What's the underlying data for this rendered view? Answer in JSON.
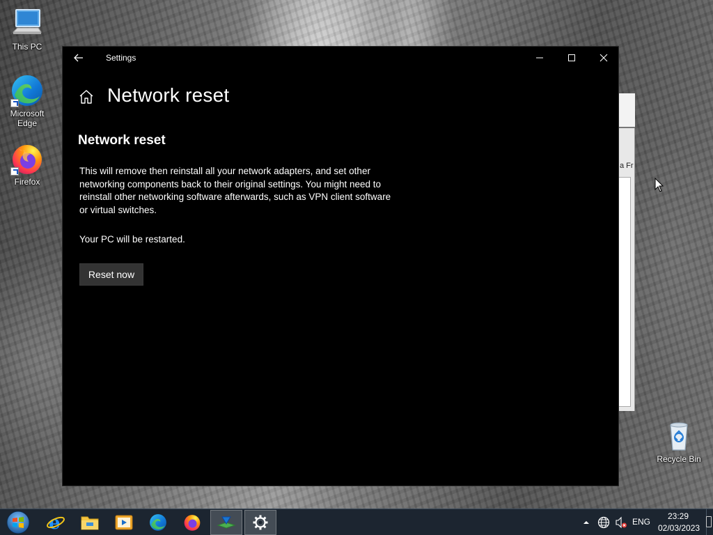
{
  "desktop": {
    "icons": [
      {
        "label": "This PC"
      },
      {
        "label": "Microsoft Edge"
      },
      {
        "label": "Firefox"
      },
      {
        "label": "Recycle Bin"
      }
    ],
    "background_window_label": "a Fr"
  },
  "settings": {
    "window_title": "Settings",
    "page_title": "Network reset",
    "section_heading": "Network reset",
    "description": "This will remove then reinstall all your network adapters, and set other networking components back to their original settings. You might need to reinstall other networking software afterwards, such as VPN client software or virtual switches.",
    "restart_note": "Your PC will be restarted.",
    "reset_button_label": "Reset now",
    "colors": {
      "background": "#000000",
      "button": "#333333",
      "text": "#ffffff"
    }
  },
  "taskbar": {
    "apps": [
      "start-icon",
      "internet-explorer-icon",
      "file-explorer-icon",
      "media-player-icon",
      "edge-icon",
      "firefox-icon",
      "network-app-icon",
      "settings-icon"
    ],
    "active_app": "settings-icon",
    "tray": {
      "language": "ENG",
      "time": "23:29",
      "date": "02/03/2023"
    }
  }
}
